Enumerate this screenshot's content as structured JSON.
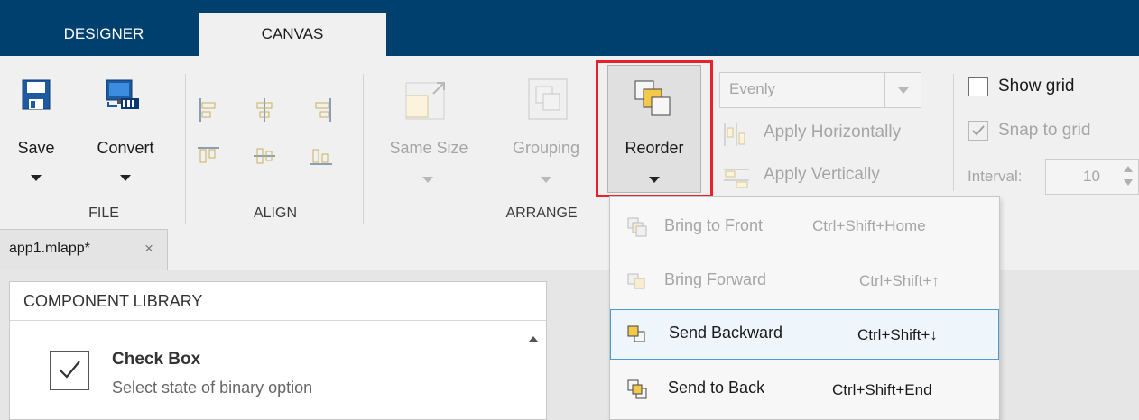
{
  "tabs": {
    "designer": "DESIGNER",
    "canvas": "CANVAS"
  },
  "file": {
    "save": "Save",
    "convert": "Convert",
    "section": "FILE"
  },
  "align": {
    "section": "ALIGN"
  },
  "arrange": {
    "same_size": "Same Size",
    "grouping": "Grouping",
    "reorder": "Reorder",
    "distribute_mode": "Evenly",
    "apply_horizontally": "Apply Horizontally",
    "apply_vertically": "Apply Vertically",
    "section": "ARRANGE"
  },
  "grid": {
    "show_grid": "Show grid",
    "show_grid_checked": false,
    "snap_to_grid": "Snap to grid",
    "snap_to_grid_checked": true,
    "interval_label": "Interval:",
    "interval_value": "10"
  },
  "document_tab": {
    "name": "app1.mlapp*",
    "close": "×"
  },
  "library": {
    "header": "COMPONENT LIBRARY",
    "item_title": "Check Box",
    "item_desc": "Select state of binary option"
  },
  "reorder_menu": [
    {
      "label": "Bring to Front",
      "shortcut": "Ctrl+Shift+Home",
      "enabled": false,
      "icon": "bring-to-front-icon"
    },
    {
      "label": "Bring Forward",
      "shortcut": "Ctrl+Shift+↑",
      "enabled": false,
      "icon": "bring-forward-icon"
    },
    {
      "label": "Send Backward",
      "shortcut": "Ctrl+Shift+↓",
      "enabled": true,
      "icon": "send-backward-icon"
    },
    {
      "label": "Send to Back",
      "shortcut": "Ctrl+Shift+End",
      "enabled": true,
      "icon": "send-to-back-icon"
    }
  ],
  "colors": {
    "tab_bar": "#00406e",
    "highlight": "#e8212b",
    "menu_hover": "#4a9ad4",
    "toolstrip": "#f0f0f0"
  }
}
